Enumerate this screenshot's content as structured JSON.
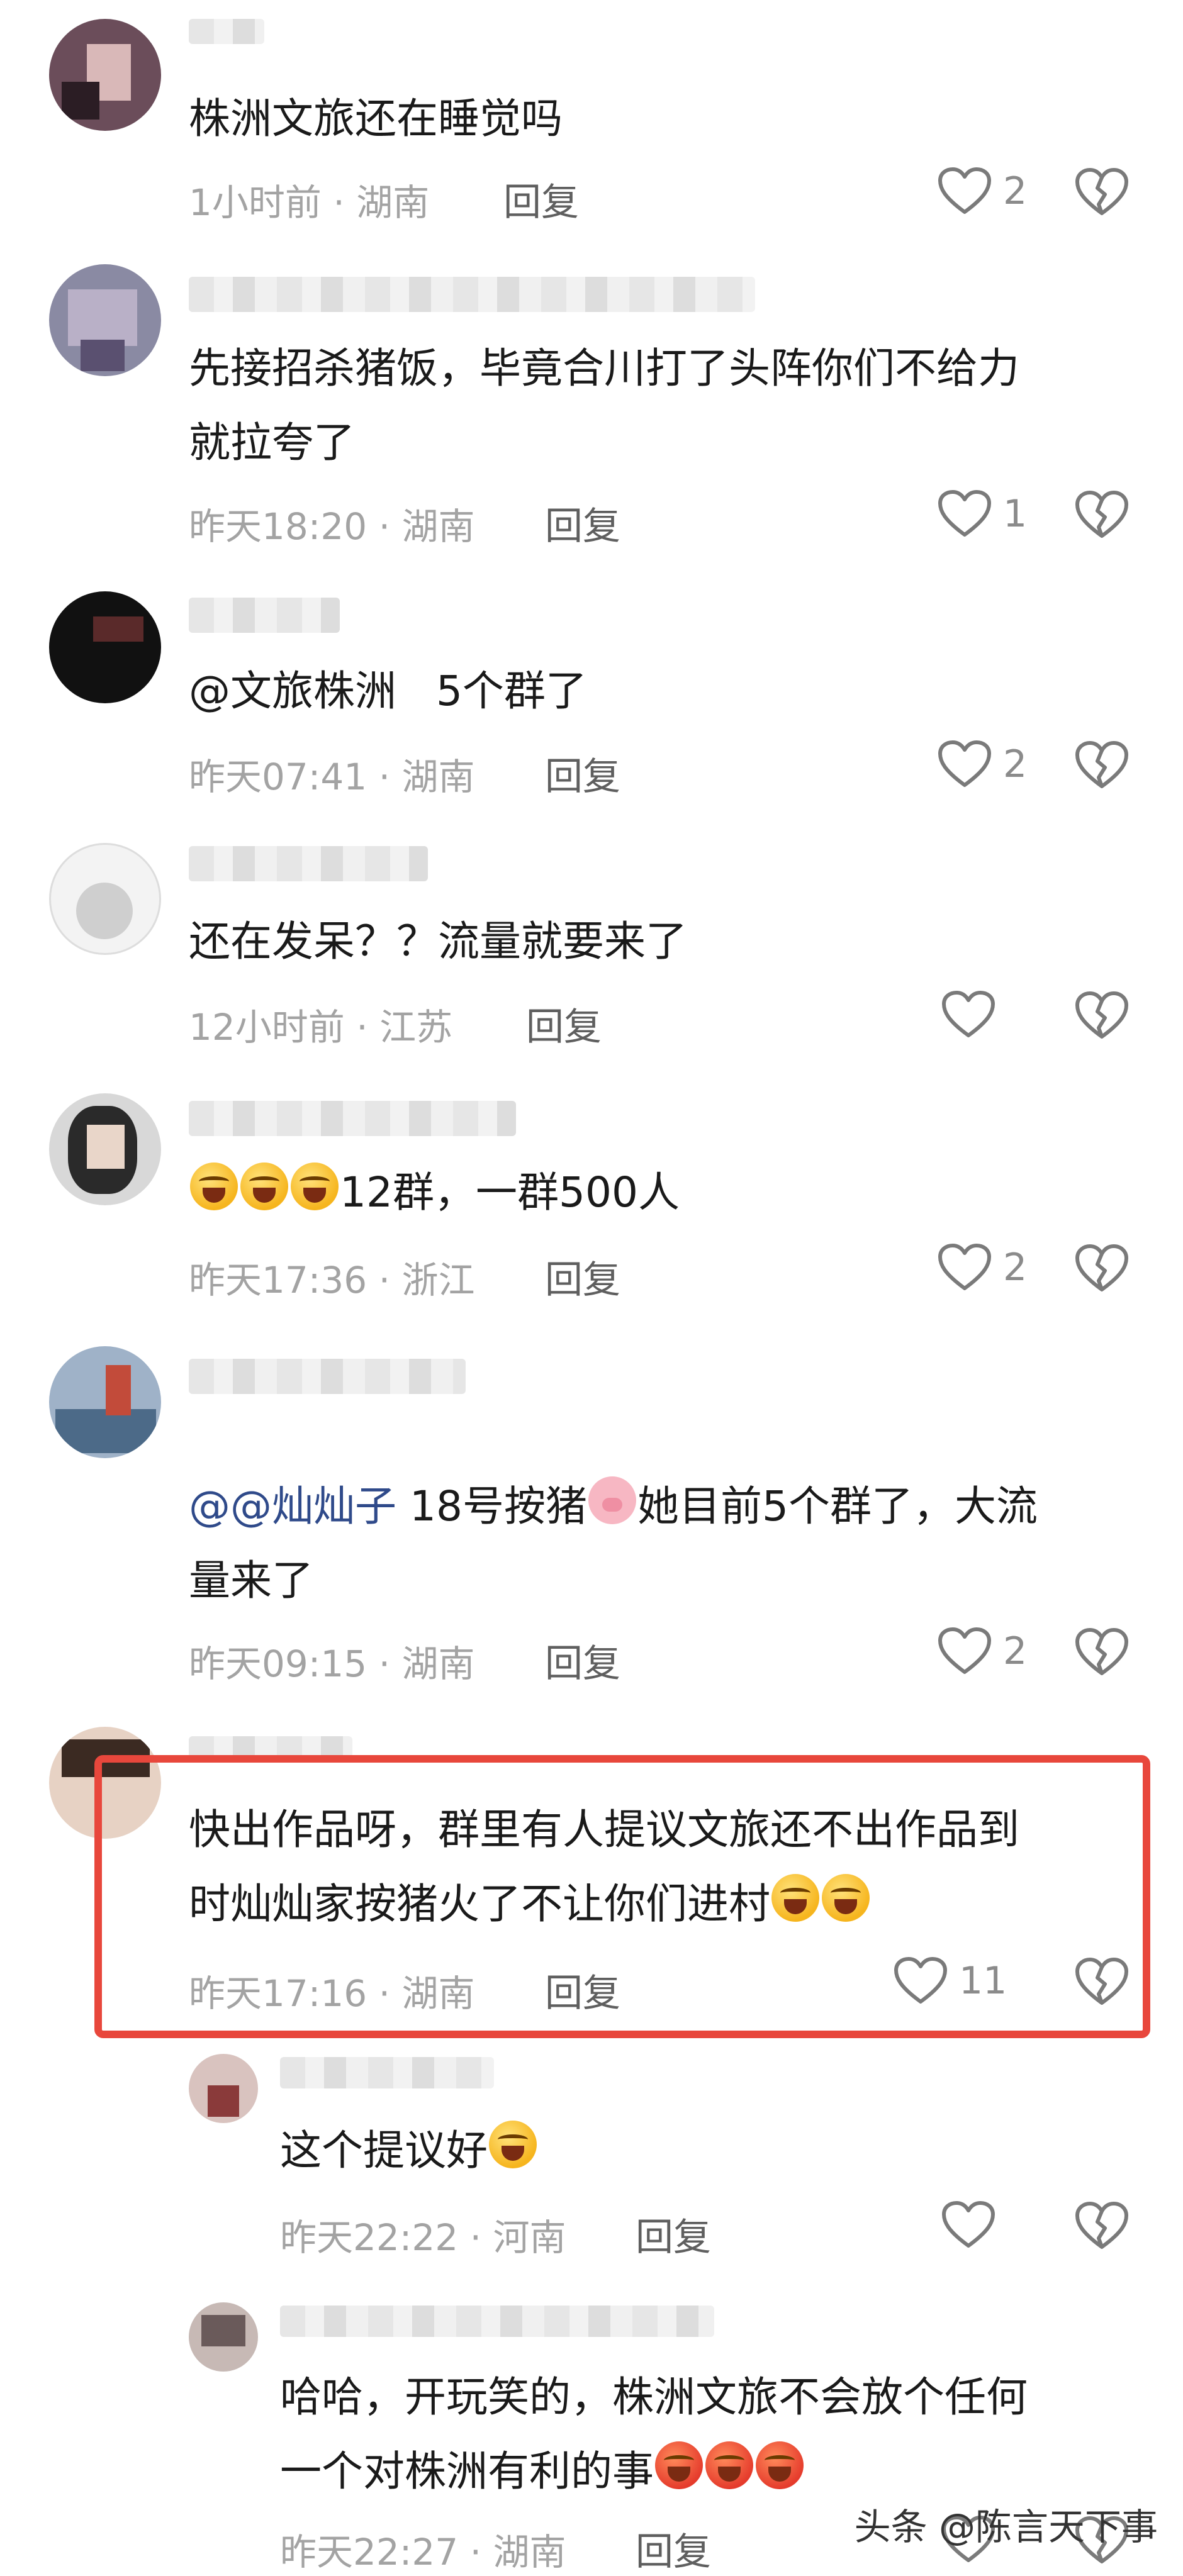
{
  "comments": [
    {
      "text": "株洲文旅还在睡觉吗",
      "time": "1小时前",
      "region": "湖南",
      "reply": "回复",
      "likes": "2"
    },
    {
      "text": "先接招杀猪饭，毕竟合川打了头阵你们不给力\n就拉夸了",
      "time": "昨天18:20",
      "region": "湖南",
      "reply": "回复",
      "likes": "1"
    },
    {
      "text": "@文旅株洲   5个群了",
      "time": "昨天07:41",
      "region": "湖南",
      "reply": "回复",
      "likes": "2"
    },
    {
      "text": "还在发呆？？流量就要来了",
      "time": "12小时前",
      "region": "江苏",
      "reply": "回复",
      "likes": ""
    },
    {
      "text": "12群，一群500人",
      "time": "昨天17:36",
      "region": "浙江",
      "reply": "回复",
      "likes": "2"
    },
    {
      "mention": "@@灿灿子",
      "text_a": " 18号按猪",
      "text_b": "她目前5个群了，大流",
      "text_c": "量来了",
      "time": "昨天09:15",
      "region": "湖南",
      "reply": "回复",
      "likes": "2"
    },
    {
      "text_a": "快出作品呀，群里有人提议文旅还不出作品到",
      "text_b": "时灿灿家按猪火了不让你们进村",
      "time": "昨天17:16",
      "region": "湖南",
      "reply": "回复",
      "likes": "11"
    }
  ],
  "replies": [
    {
      "text": "这个提议好",
      "time": "昨天22:22",
      "region": "河南",
      "reply": "回复",
      "likes": ""
    },
    {
      "text_a": "哈哈，开玩笑的，株洲文旅不会放个任何",
      "text_b": "一个对株洲有利的事",
      "time": "昨天22:27",
      "region": "湖南",
      "reply": "回复"
    }
  ],
  "separator": " · ",
  "watermark": "头条 @陈言天下事",
  "icons": {
    "like": "heart-outline-icon",
    "dislike": "broken-heart-icon"
  },
  "colors": {
    "highlight": "#e8473c",
    "mention": "#2f4a8a",
    "meta": "#a3a3a3"
  }
}
